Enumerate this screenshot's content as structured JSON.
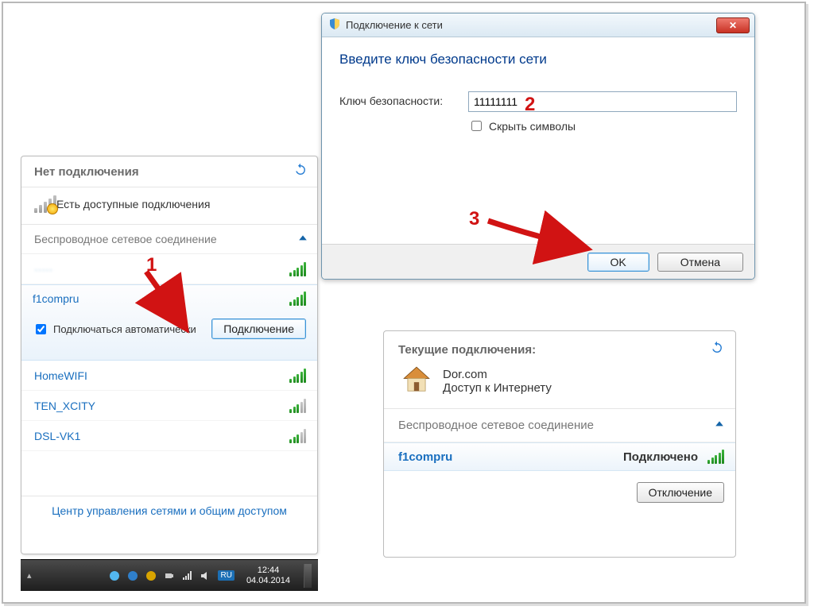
{
  "panel1": {
    "title": "Нет подключения",
    "avail": "Есть доступные подключения",
    "section": "Беспроводное сетевое соединение",
    "blurred_ssid": "—",
    "networks": {
      "selected": {
        "name": "f1compru",
        "auto_label": "Подключаться автоматически",
        "connect_btn": "Подключение"
      },
      "n2": "HomeWIFI",
      "n3": "TEN_XCITY",
      "n4": "DSL-VK1"
    },
    "footer": "Центр управления сетями и общим доступом"
  },
  "panel2": {
    "window_title": "Подключение к сети",
    "prompt": "Введите ключ безопасности сети",
    "key_label": "Ключ безопасности:",
    "key_value": "11111111",
    "hide_label": "Скрыть символы",
    "ok": "OK",
    "cancel": "Отмена"
  },
  "panel3": {
    "title": "Текущие подключения:",
    "home_line1": "Dor.com",
    "home_line2": "Доступ к Интернету",
    "section": "Беспроводное сетевое соединение",
    "ssid": "f1compru",
    "status": "Подключено",
    "disconnect": "Отключение"
  },
  "steps": {
    "s1": "1",
    "s2": "2",
    "s3": "3"
  },
  "taskbar": {
    "lang": "RU",
    "time": "12:44",
    "date": "04.04.2014"
  }
}
